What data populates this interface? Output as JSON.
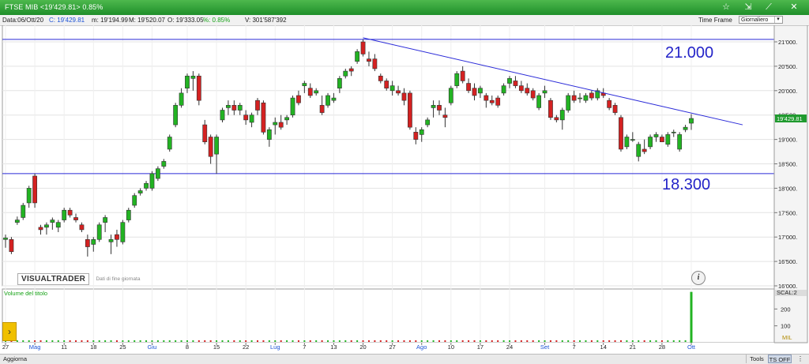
{
  "window": {
    "title": "FTSE MIB <19'429.81> 0.85%",
    "icons": [
      "star-icon",
      "chart-cursor-icon",
      "crosshair-icon",
      "close-icon"
    ]
  },
  "infobar": {
    "date": "Data:06/Ott/20",
    "close": "C: 19'429.81",
    "min": "m: 19'194.99",
    "max": "M: 19'520.07",
    "open": "O: 19'333.05",
    "change": "%: 0.85%",
    "volume": "V: 301'587'392",
    "timeframe_label": "Time Frame",
    "timeframe_value": "Giornaliero",
    "colors": {
      "close": "#1c52d6",
      "change": "#16a216"
    }
  },
  "watermark": {
    "logo": "VISUALTRADER",
    "subtitle": "Dati di fine giornata"
  },
  "volume_panel": {
    "label": "Volume del titolo",
    "mil_label": "MIL"
  },
  "statusbar": {
    "aggiorna": "Aggiorna",
    "tools": "Tools",
    "ts_off": "TS OFF"
  },
  "chart_data": {
    "type": "candlestick",
    "ylim": [
      16000,
      21000
    ],
    "ytick_labels": [
      "16'000.",
      "16'500.",
      "17'000.",
      "17'500.",
      "18'000.",
      "18'500.",
      "19'000.",
      "19'500.",
      "20'000.",
      "20'500.",
      "21'000."
    ],
    "price_tag": "19'429.81",
    "xtick_labels": [
      {
        "label": "27",
        "month": false
      },
      {
        "label": "Mag",
        "month": true
      },
      {
        "label": "11",
        "month": false
      },
      {
        "label": "18",
        "month": false
      },
      {
        "label": "25",
        "month": false
      },
      {
        "label": "Giu",
        "month": true
      },
      {
        "label": "8",
        "month": false
      },
      {
        "label": "15",
        "month": false
      },
      {
        "label": "22",
        "month": false
      },
      {
        "label": "Lug",
        "month": true
      },
      {
        "label": "7",
        "month": false
      },
      {
        "label": "13",
        "month": false
      },
      {
        "label": "20",
        "month": false
      },
      {
        "label": "27",
        "month": false
      },
      {
        "label": "Ago",
        "month": true
      },
      {
        "label": "10",
        "month": false
      },
      {
        "label": "17",
        "month": false
      },
      {
        "label": "24",
        "month": false
      },
      {
        "label": "Set",
        "month": true
      },
      {
        "label": "7",
        "month": false
      },
      {
        "label": "14",
        "month": false
      },
      {
        "label": "21",
        "month": false
      },
      {
        "label": "28",
        "month": false
      },
      {
        "label": "Ott",
        "month": true
      }
    ],
    "annotations": [
      {
        "text": "21.000",
        "level": 21000
      },
      {
        "text": "18.300",
        "level": 18300
      }
    ],
    "horizontal_lines": [
      21050,
      18300
    ],
    "colors": {
      "up": "#22b322",
      "down": "#d42121",
      "lines": "#2a2ad8",
      "annotation": "#2323c8"
    },
    "candles": [
      [
        16950,
        17050,
        16780,
        16980
      ],
      [
        16950,
        17000,
        16650,
        16700
      ],
      [
        17300,
        17420,
        17250,
        17350
      ],
      [
        17400,
        17700,
        17350,
        17650
      ],
      [
        17700,
        18050,
        17600,
        18000
      ],
      [
        18250,
        18300,
        17600,
        17700
      ],
      [
        17200,
        17250,
        17050,
        17150
      ],
      [
        17200,
        17300,
        17050,
        17250
      ],
      [
        17300,
        17400,
        17150,
        17350
      ],
      [
        17200,
        17350,
        17100,
        17300
      ],
      [
        17350,
        17600,
        17300,
        17550
      ],
      [
        17550,
        17600,
        17400,
        17450
      ],
      [
        17400,
        17480,
        17300,
        17350
      ],
      [
        17250,
        17300,
        17100,
        17150
      ],
      [
        16950,
        17050,
        16600,
        16800
      ],
      [
        16850,
        17000,
        16700,
        16950
      ],
      [
        16950,
        17300,
        16900,
        17250
      ],
      [
        17300,
        17450,
        17100,
        17400
      ],
      [
        16900,
        17050,
        16650,
        16950
      ],
      [
        17050,
        17150,
        16800,
        16950
      ],
      [
        16900,
        17350,
        16850,
        17300
      ],
      [
        17350,
        17600,
        17300,
        17550
      ],
      [
        17650,
        17900,
        17600,
        17850
      ],
      [
        17900,
        18000,
        17850,
        17950
      ],
      [
        18000,
        18150,
        17950,
        18100
      ],
      [
        18000,
        18350,
        17950,
        18300
      ],
      [
        18200,
        18450,
        18150,
        18400
      ],
      [
        18450,
        18600,
        18400,
        18550
      ],
      [
        18800,
        19100,
        18750,
        19050
      ],
      [
        19300,
        19750,
        19250,
        19700
      ],
      [
        19700,
        20050,
        19650,
        19950
      ],
      [
        20050,
        20350,
        19950,
        20300
      ],
      [
        20250,
        20400,
        20000,
        20300
      ],
      [
        20300,
        20350,
        19700,
        19800
      ],
      [
        19300,
        19400,
        18900,
        18950
      ],
      [
        19050,
        19100,
        18500,
        18650
      ],
      [
        18700,
        19100,
        18300,
        19050
      ],
      [
        19400,
        19650,
        19350,
        19600
      ],
      [
        19650,
        19800,
        19500,
        19700
      ],
      [
        19700,
        19800,
        19500,
        19600
      ],
      [
        19600,
        19750,
        19500,
        19700
      ],
      [
        19500,
        19600,
        19300,
        19400
      ],
      [
        19350,
        19550,
        19250,
        19500
      ],
      [
        19800,
        19850,
        19500,
        19600
      ],
      [
        19750,
        19800,
        19100,
        19150
      ],
      [
        19000,
        19250,
        18850,
        19200
      ],
      [
        19300,
        19450,
        19100,
        19350
      ],
      [
        19350,
        19500,
        19200,
        19250
      ],
      [
        19400,
        19500,
        19300,
        19450
      ],
      [
        19500,
        19900,
        19450,
        19850
      ],
      [
        19900,
        20000,
        19700,
        19750
      ],
      [
        20100,
        20200,
        19950,
        20150
      ],
      [
        20050,
        20150,
        19850,
        19900
      ],
      [
        19950,
        20050,
        19900,
        20000
      ],
      [
        19700,
        19900,
        19500,
        19550
      ],
      [
        19700,
        19950,
        19650,
        19900
      ],
      [
        19800,
        19950,
        19750,
        19850
      ],
      [
        20050,
        20300,
        19950,
        20250
      ],
      [
        20300,
        20450,
        20250,
        20400
      ],
      [
        20450,
        20500,
        20300,
        20400
      ],
      [
        20600,
        20850,
        20550,
        20800
      ],
      [
        21000,
        21050,
        20700,
        20750
      ],
      [
        20650,
        20800,
        20500,
        20600
      ],
      [
        20650,
        20750,
        20400,
        20450
      ],
      [
        20300,
        20350,
        20150,
        20200
      ],
      [
        20200,
        20250,
        20000,
        20050
      ],
      [
        20000,
        20200,
        19900,
        20100
      ],
      [
        20000,
        20100,
        19900,
        19950
      ],
      [
        19950,
        20050,
        19700,
        19800
      ],
      [
        19950,
        20000,
        19200,
        19250
      ],
      [
        19150,
        19250,
        18900,
        19000
      ],
      [
        19100,
        19250,
        18950,
        19200
      ],
      [
        19300,
        19450,
        19250,
        19400
      ],
      [
        19650,
        19800,
        19450,
        19700
      ],
      [
        19700,
        19800,
        19500,
        19600
      ],
      [
        19500,
        19650,
        19250,
        19450
      ],
      [
        19750,
        20100,
        19700,
        20050
      ],
      [
        20100,
        20400,
        20050,
        20350
      ],
      [
        20400,
        20500,
        20150,
        20200
      ],
      [
        20150,
        20250,
        19950,
        20000
      ],
      [
        20050,
        20150,
        19800,
        19900
      ],
      [
        19950,
        20100,
        19850,
        20050
      ],
      [
        19900,
        19950,
        19650,
        19800
      ],
      [
        19800,
        19900,
        19700,
        19750
      ],
      [
        19850,
        19900,
        19650,
        19700
      ],
      [
        19950,
        20150,
        19900,
        20100
      ],
      [
        20150,
        20300,
        20050,
        20250
      ],
      [
        20200,
        20300,
        20050,
        20100
      ],
      [
        20100,
        20200,
        19950,
        20000
      ],
      [
        20050,
        20150,
        19900,
        19950
      ],
      [
        20000,
        20050,
        19800,
        19850
      ],
      [
        19650,
        19950,
        19600,
        19900
      ],
      [
        19950,
        20100,
        19850,
        20000
      ],
      [
        19800,
        19850,
        19400,
        19450
      ],
      [
        19450,
        19500,
        19350,
        19400
      ],
      [
        19400,
        19650,
        19200,
        19600
      ],
      [
        19600,
        19950,
        19550,
        19900
      ],
      [
        19900,
        20000,
        19750,
        19800
      ],
      [
        19850,
        19950,
        19750,
        19850
      ],
      [
        19800,
        19950,
        19750,
        19900
      ],
      [
        19950,
        20000,
        19800,
        19850
      ],
      [
        19850,
        20050,
        19800,
        20000
      ],
      [
        19950,
        20050,
        19850,
        19900
      ],
      [
        19800,
        19850,
        19600,
        19650
      ],
      [
        19700,
        19750,
        19500,
        19550
      ],
      [
        19450,
        19500,
        18750,
        18800
      ],
      [
        18850,
        19100,
        18800,
        19050
      ],
      [
        19000,
        19150,
        18950,
        19000
      ],
      [
        18650,
        18950,
        18550,
        18900
      ],
      [
        18800,
        19000,
        18700,
        18750
      ],
      [
        18850,
        19100,
        18800,
        19050
      ],
      [
        19050,
        19150,
        18950,
        19100
      ],
      [
        19050,
        19100,
        18950,
        18950
      ],
      [
        18900,
        19150,
        18850,
        19100
      ],
      [
        19150,
        19200,
        19050,
        19150
      ],
      [
        18800,
        19150,
        18750,
        19100
      ],
      [
        19200,
        19300,
        19150,
        19250
      ],
      [
        19333,
        19520,
        19195,
        19430
      ]
    ],
    "volume": {
      "ytick_labels": [
        "100",
        "200",
        "SCAL:2"
      ],
      "last_bar_value": 301.6,
      "ylim": [
        0,
        300
      ],
      "bar_color": "#22b322"
    }
  }
}
